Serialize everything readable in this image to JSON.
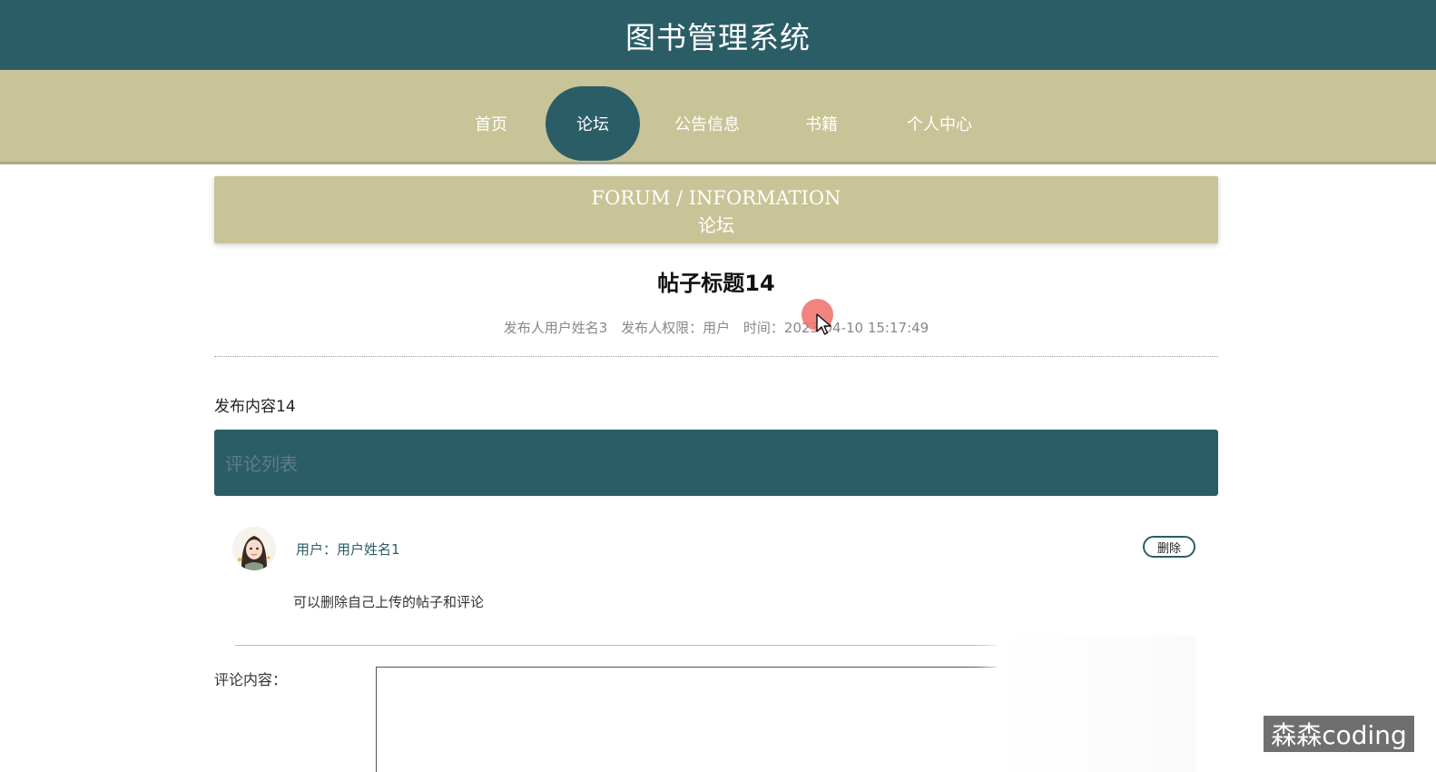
{
  "header": {
    "title": "图书管理系统"
  },
  "nav": {
    "items": [
      {
        "label": "首页",
        "active": false
      },
      {
        "label": "论坛",
        "active": true
      },
      {
        "label": "公告信息",
        "active": false
      },
      {
        "label": "书籍",
        "active": false
      },
      {
        "label": "个人中心",
        "active": false
      }
    ]
  },
  "banner": {
    "english": "FORUM / INFORMATION",
    "chinese": "论坛"
  },
  "post": {
    "title": "帖子标题14",
    "meta_author": "发布人用户姓名3",
    "meta_role": "发布人权限：用户",
    "meta_time": "时间：2023-04-10 15:17:49",
    "content": "发布内容14"
  },
  "comments": {
    "header_label": "评论列表",
    "items": [
      {
        "user": "用户：用户姓名1",
        "delete_label": "删除",
        "text": "可以删除自己上传的帖子和评论"
      }
    ]
  },
  "comment_form": {
    "label": "评论内容：",
    "value": ""
  },
  "watermark": "森森coding",
  "colors": {
    "primary": "#2b5d66",
    "khaki": "#c8c497",
    "white": "#ffffff"
  }
}
